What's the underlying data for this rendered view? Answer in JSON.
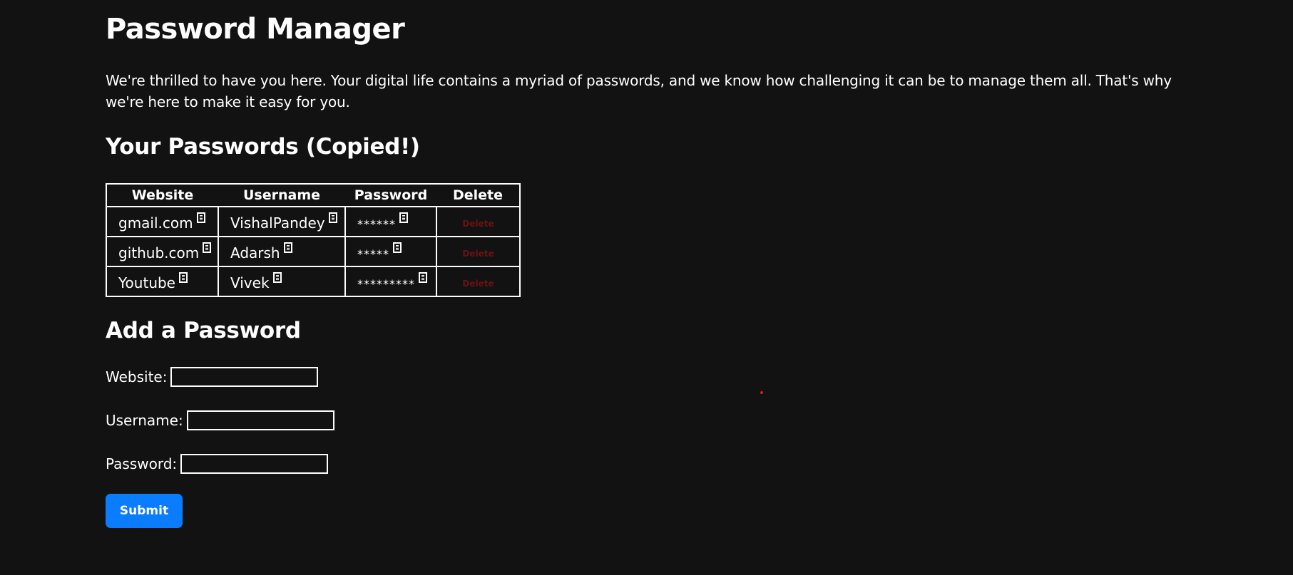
{
  "page": {
    "title": "Password Manager",
    "intro": "We're thrilled to have you here. Your digital life contains a myriad of passwords, and we know how challenging it can be to manage them all. That's why we're here to make it easy for you."
  },
  "passwords_section": {
    "heading": "Your Passwords (Copied!)",
    "columns": [
      "Website",
      "Username",
      "Password",
      "Delete"
    ],
    "rows": [
      {
        "website": "gmail.com",
        "username": "VishalPandey",
        "password": "******",
        "delete_label": "Delete"
      },
      {
        "website": "github.com",
        "username": "Adarsh",
        "password": "*****",
        "delete_label": "Delete"
      },
      {
        "website": "Youtube",
        "username": "Vivek",
        "password": "*********",
        "delete_label": "Delete"
      }
    ]
  },
  "add_section": {
    "heading": "Add a Password",
    "website_label": "Website:",
    "username_label": "Username:",
    "password_label": "Password:",
    "website_value": "",
    "username_value": "",
    "password_value": "",
    "submit_label": "Submit"
  },
  "icons": {
    "copy": "copy-icon"
  },
  "colors": {
    "background": "#121212",
    "text": "#ffffff",
    "submit": "#0a7cff",
    "delete_text": "#6b1212",
    "dot": "#d42020"
  }
}
